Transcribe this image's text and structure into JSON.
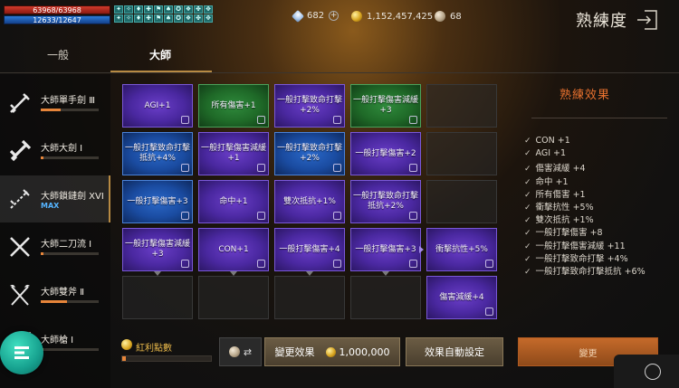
{
  "status": {
    "hp": "63968/63968",
    "mp": "12633/12647",
    "buff_count": 20
  },
  "currencies": {
    "diamond": "682",
    "gold": "1,152,457,425",
    "silver": "68"
  },
  "page": {
    "title": "熟練度"
  },
  "tabs": [
    {
      "label": "一般"
    },
    {
      "label": "大師"
    }
  ],
  "skills": [
    {
      "name": "大師單手劍 Ⅲ",
      "progress": 0.35
    },
    {
      "name": "大師大劍 Ⅰ",
      "progress": 0.05
    },
    {
      "name": "大師鎖鏈劍 XVI",
      "max": "MAX"
    },
    {
      "name": "大師二刀流 Ⅰ",
      "progress": 0.05
    },
    {
      "name": "大師雙斧 Ⅱ",
      "progress": 0.45
    },
    {
      "name": "大師槍 Ⅰ",
      "progress": 0.05
    }
  ],
  "grid": [
    [
      {
        "label": "AGI+1",
        "color": "purple"
      },
      {
        "label": "所有傷害+1",
        "color": "green"
      },
      {
        "label": "一般打擊致命打擊+2%",
        "color": "purple"
      },
      {
        "label": "一般打擊傷害減緩+3",
        "color": "green"
      },
      {
        "label": "",
        "color": "empty"
      }
    ],
    [
      {
        "label": "一般打擊致命打擊抵抗+4%",
        "color": "blue"
      },
      {
        "label": "一般打擊傷害減緩+1",
        "color": "purple"
      },
      {
        "label": "一般打擊致命打擊+2%",
        "color": "blue"
      },
      {
        "label": "一般打擊傷害+2",
        "color": "purple"
      },
      {
        "label": "",
        "color": "empty"
      }
    ],
    [
      {
        "label": "一般打擊傷害+3",
        "color": "blue"
      },
      {
        "label": "命中+1",
        "color": "purple"
      },
      {
        "label": "雙次抵抗+1%",
        "color": "purple"
      },
      {
        "label": "一般打擊致命打擊抵抗+2%",
        "color": "purple"
      },
      {
        "label": "",
        "color": "empty"
      }
    ],
    [
      {
        "label": "一般打擊傷害減緩+3",
        "color": "purple"
      },
      {
        "label": "CON+1",
        "color": "purple"
      },
      {
        "label": "一般打擊傷害+4",
        "color": "purple"
      },
      {
        "label": "一般打擊傷害+3",
        "color": "purple"
      },
      {
        "label": "衝擊抗性+5%",
        "color": "purple"
      }
    ],
    [
      {
        "label": "",
        "color": "empty"
      },
      {
        "label": "",
        "color": "empty"
      },
      {
        "label": "",
        "color": "empty"
      },
      {
        "label": "",
        "color": "empty"
      },
      {
        "label": "傷害減緩+4",
        "color": "purple"
      }
    ]
  ],
  "effects": {
    "title": "熟練效果",
    "items": [
      "CON +1",
      "AGI +1",
      "傷害減緩 +4",
      "命中 +1",
      "所有傷害 +1",
      "衝擊抗性 +5%",
      "雙次抵抗 +1%",
      "一般打擊傷害 +8",
      "一般打擊傷害減緩 +11",
      "一般打擊致命打擊 +4%",
      "一般打擊致命打擊抵抗 +6%"
    ]
  },
  "bottom": {
    "bonus_label": "紅利點數",
    "bonus_progress": 0.04,
    "change_label": "變更效果",
    "change_cost": "1,000,000",
    "auto_label": "效果自動設定",
    "apply_label": "變更"
  },
  "colors": {
    "accent": "#e6702e",
    "tab_underline": "#b78a43"
  },
  "icons": [
    "diamond-icon",
    "gold-coin-icon",
    "silver-coin-icon",
    "exit-icon",
    "sword-icon",
    "lock-icon",
    "swap-icon",
    "menu-icon"
  ]
}
